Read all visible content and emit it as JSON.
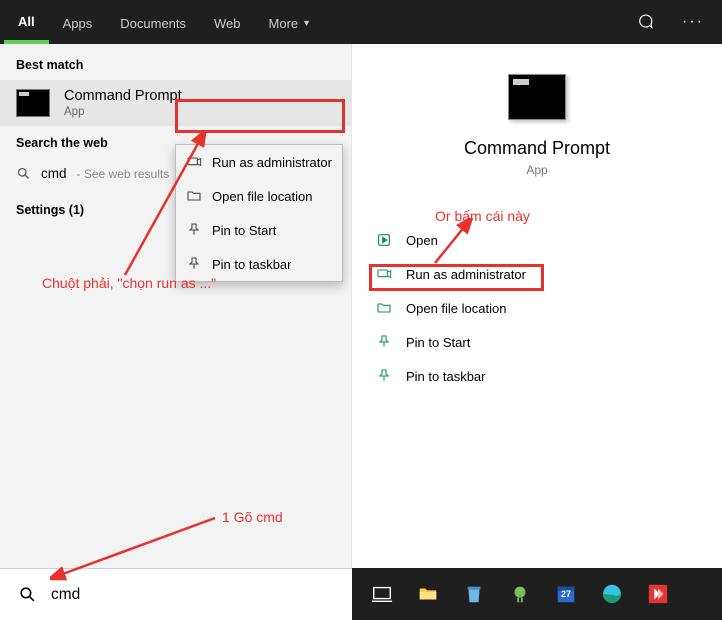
{
  "topbar": {
    "tabs": {
      "all": "All",
      "apps": "Apps",
      "documents": "Documents",
      "web": "Web",
      "more": "More"
    }
  },
  "left": {
    "best_match_header": "Best match",
    "result_name": "Command Prompt",
    "result_type": "App",
    "search_web_header": "Search the web",
    "web_query": "cmd",
    "web_hint": "- See web results",
    "settings_header": "Settings (1)"
  },
  "context_menu": {
    "run_admin": "Run as administrator",
    "open_loc": "Open file location",
    "pin_start": "Pin to Start",
    "pin_taskbar": "Pin to taskbar"
  },
  "right": {
    "app_name": "Command Prompt",
    "app_type": "App",
    "actions": {
      "open": "Open",
      "run_admin": "Run as administrator",
      "open_loc": "Open file location",
      "pin_start": "Pin to Start",
      "pin_taskbar": "Pin to taskbar"
    }
  },
  "search_input": {
    "value": "cmd"
  },
  "annotations": {
    "text_left": "Chuột phải, \"chọn run as ...\"",
    "text_right": "Or bấm cái này",
    "text_bottom": "1 Gõ cmd"
  },
  "taskbar_date_badge": "27"
}
